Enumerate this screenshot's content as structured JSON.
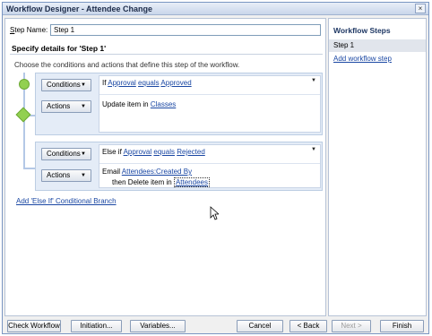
{
  "window": {
    "title": "Workflow Designer - Attendee Change",
    "close_glyph": "×"
  },
  "step_name": {
    "label_key": "S",
    "label_rest": "tep Name:",
    "value": "Step 1"
  },
  "details_header": "Specify details for 'Step 1'",
  "instruction": "Choose the conditions and actions that define this step of the workflow.",
  "branches": [
    {
      "conditions_label": "Conditions",
      "actions_label": "Actions",
      "condition": {
        "prefix": "If",
        "field": "Approval",
        "op": "equals",
        "value": "Approved"
      },
      "action": {
        "text": "Update item in",
        "target": "Classes"
      }
    },
    {
      "conditions_label": "Conditions",
      "actions_label": "Actions",
      "condition": {
        "prefix": "Else if",
        "field": "Approval",
        "op": "equals",
        "value": "Rejected"
      },
      "action": {
        "text": "Email",
        "target": "Attendees:Created By"
      },
      "action2": {
        "text": "then Delete item in",
        "target": "Attendees"
      }
    }
  ],
  "add_else_link": "Add 'Else If' Conditional Branch",
  "sidebar": {
    "title": "Workflow Steps",
    "step": "Step 1",
    "add_link": "Add workflow step"
  },
  "buttons": {
    "check": "Check Workflow",
    "initiation": "Initiation...",
    "variables": "Variables...",
    "cancel": "Cancel",
    "back": "< Back",
    "next": "Next >",
    "finish": "Finish"
  },
  "colors": {
    "link": "#1a47a3",
    "block_bg": "#e4ecf7",
    "node_green": "#92d050"
  }
}
